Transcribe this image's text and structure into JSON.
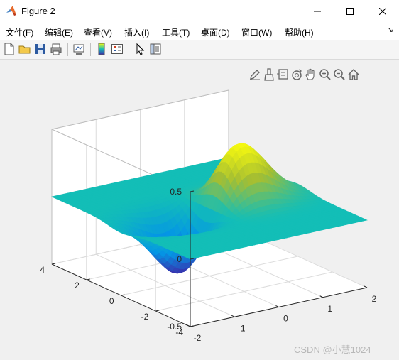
{
  "window": {
    "title": "Figure 2",
    "controls": [
      "minimize",
      "maximize",
      "close"
    ]
  },
  "menu": {
    "items": [
      {
        "id": "file",
        "label": "文件(F)"
      },
      {
        "id": "edit",
        "label": "编辑(E)"
      },
      {
        "id": "view",
        "label": "查看(V)"
      },
      {
        "id": "insert",
        "label": "插入(I)"
      },
      {
        "id": "tools",
        "label": "工具(T)"
      },
      {
        "id": "desktop",
        "label": "桌面(D)"
      },
      {
        "id": "window",
        "label": "窗口(W)"
      },
      {
        "id": "help",
        "label": "帮助(H)"
      }
    ]
  },
  "toolbar": {
    "buttons": [
      "new-figure-icon",
      "open-file-icon",
      "save-icon",
      "print-icon",
      "link-plot-icon",
      "colorbar-icon",
      "legend-icon",
      "edit-plot-icon",
      "property-inspector-icon"
    ]
  },
  "axes_toolbar": {
    "buttons": [
      "edit-icon",
      "brush-icon",
      "data-tips-icon",
      "rotate-3d-icon",
      "pan-icon",
      "zoom-in-icon",
      "zoom-out-icon",
      "home-icon"
    ]
  },
  "chart_data": {
    "type": "surface",
    "x": [
      -2,
      -1,
      0,
      1,
      2
    ],
    "y": [
      -4,
      -2,
      0,
      2,
      4
    ],
    "z_ticks": [
      -0.5,
      0,
      0.5
    ],
    "xticks": [
      "-2",
      "-1",
      "0",
      "1",
      "2"
    ],
    "yticks": [
      "-4",
      "-2",
      "0",
      "2",
      "4"
    ],
    "zticks": [
      "-0.5",
      "0",
      "0.5"
    ],
    "xlim": [
      -2,
      2
    ],
    "ylim": [
      -4,
      4
    ],
    "zlim": [
      -0.5,
      0.5
    ],
    "grid": true,
    "colormap": "parula",
    "colors": {
      "low": "#3e26a8",
      "mid": "#13beb7",
      "high": "#f9fb0e"
    },
    "peaks": [
      {
        "x": 0.7,
        "y": 0,
        "z": 0.43
      },
      {
        "x": -0.7,
        "y": 0,
        "z": -0.43
      }
    ]
  },
  "watermark": "CSDN @小慧1024"
}
